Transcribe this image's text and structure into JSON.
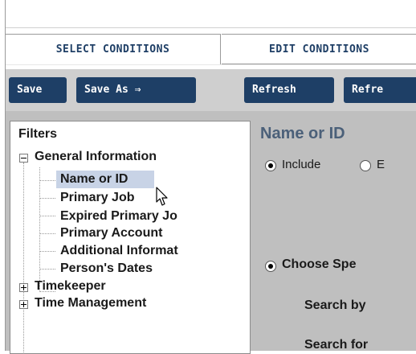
{
  "tabs": [
    {
      "label": "SELECT CONDITIONS",
      "active": true
    },
    {
      "label": "EDIT CONDITIONS",
      "active": false
    }
  ],
  "toolbar": {
    "save": "Save",
    "save_as": "Save As ⇒",
    "refresh": "Refresh",
    "refresh_partial": "Refre"
  },
  "tree": {
    "root": "Filters",
    "groups": [
      {
        "label": "General Information",
        "expanded": true,
        "items": [
          "Name or ID",
          "Primary Job",
          "Expired Primary Jo",
          "Primary Account",
          "Additional Informat",
          "Person's Dates"
        ]
      },
      {
        "label": "Timekeeper",
        "expanded": false
      },
      {
        "label": "Time Management",
        "expanded": false
      }
    ],
    "selected": "Name or ID"
  },
  "panel": {
    "title": "Name or ID",
    "include_label": "Include",
    "exclude_partial": "E",
    "choose_label": "Choose Spe",
    "search_by": "Search by",
    "search_for": "Search for"
  },
  "colors": {
    "button_bg": "#1e3f66",
    "tab_text": "#1f3f66",
    "panel_bg": "#bfbfbf",
    "selection_bg": "#c8d3e6",
    "title_color": "#4b6079"
  }
}
